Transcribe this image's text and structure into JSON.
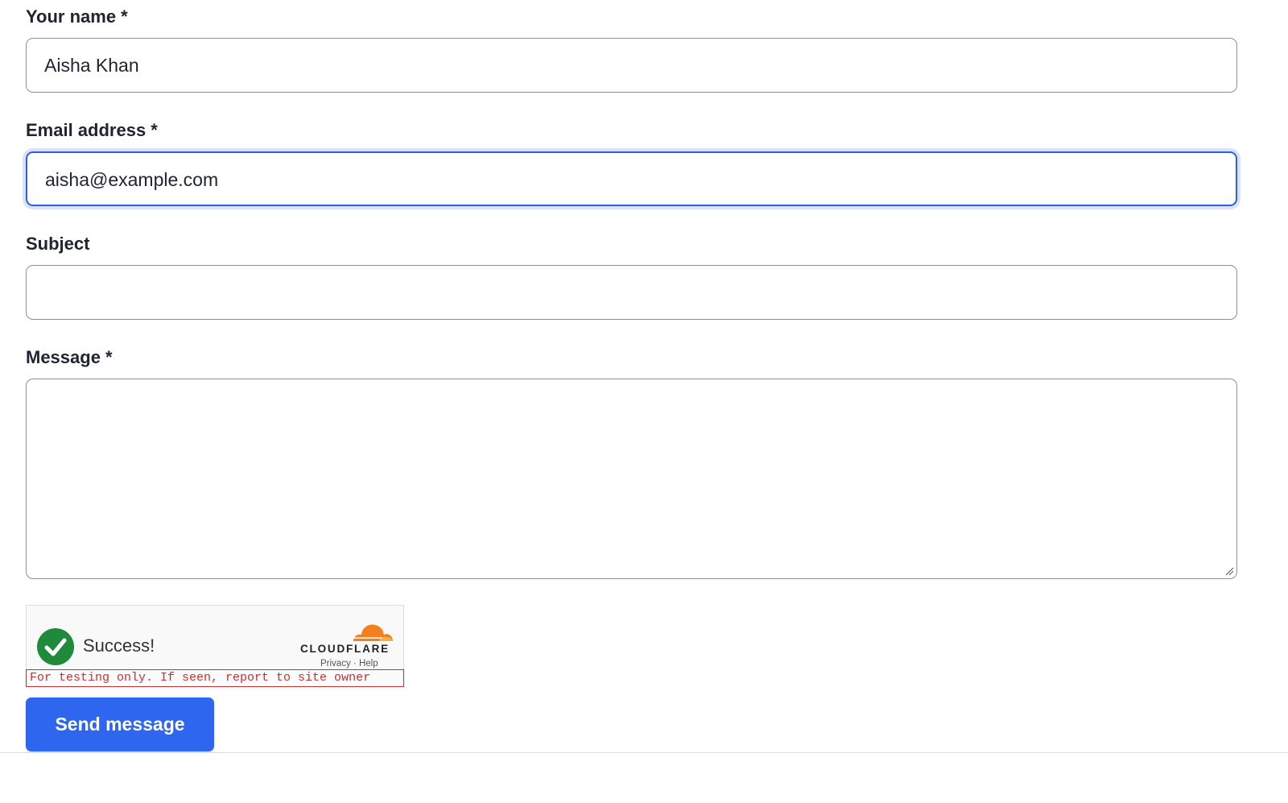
{
  "form": {
    "name": {
      "label": "Your name *",
      "value": "Aisha Khan"
    },
    "email": {
      "label": "Email address *",
      "value": "aisha@example.com"
    },
    "subject": {
      "label": "Subject",
      "value": ""
    },
    "message": {
      "label": "Message *",
      "value": ""
    },
    "send_label": "Send message"
  },
  "captcha": {
    "status_text": "Success!",
    "provider": "CLOUDFLARE",
    "privacy_link": "Privacy",
    "link_separator": "·",
    "help_link": "Help",
    "test_notice": "For testing only. If seen, report to site owner"
  },
  "colors": {
    "accent": "#2f66f0",
    "focus_ring": "#2f5fe0",
    "success": "#1f8a3b",
    "cloudflare_orange": "#f38020",
    "warning_red": "#c93030"
  }
}
